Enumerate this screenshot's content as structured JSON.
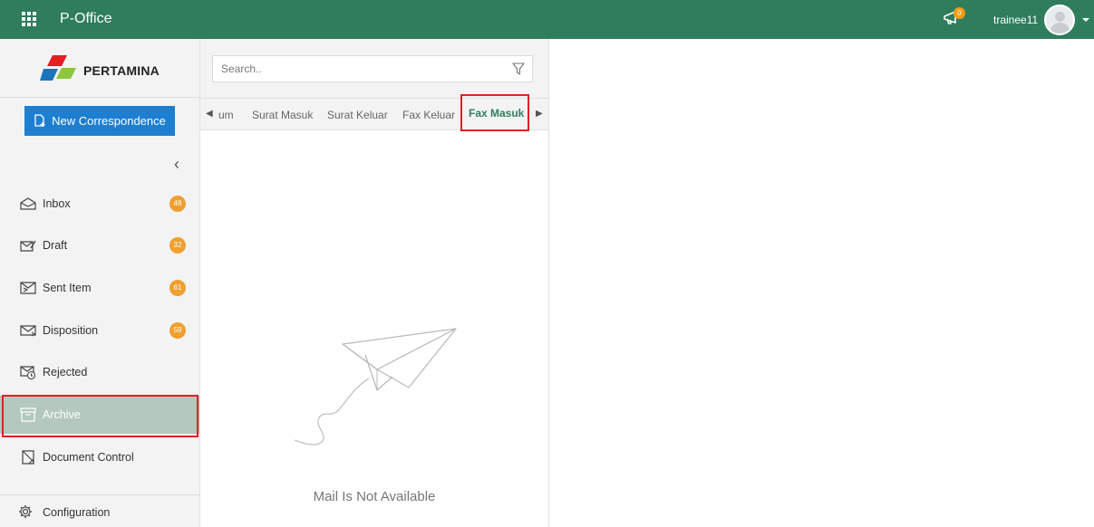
{
  "app": {
    "title": "P-Office"
  },
  "header": {
    "notification_count": "0",
    "username": "trainee11"
  },
  "sidebar": {
    "logo_text": "PERTAMINA",
    "new_button_label": "New Correspondence",
    "items": [
      {
        "label": "Inbox",
        "badge": "48",
        "icon": "inbox-icon"
      },
      {
        "label": "Draft",
        "badge": "32",
        "icon": "draft-icon"
      },
      {
        "label": "Sent Item",
        "badge": "61",
        "icon": "sent-icon"
      },
      {
        "label": "Disposition",
        "badge": "59",
        "icon": "disposition-icon"
      },
      {
        "label": "Rejected",
        "badge": "",
        "icon": "rejected-icon"
      },
      {
        "label": "Archive",
        "badge": "",
        "icon": "archive-icon",
        "active": true
      },
      {
        "label": "Document Control",
        "badge": "",
        "icon": "document-control-icon"
      }
    ],
    "configuration_label": "Configuration"
  },
  "search": {
    "placeholder": "Search.."
  },
  "tabs": [
    {
      "label": "um"
    },
    {
      "label": "Surat Masuk"
    },
    {
      "label": "Surat Keluar"
    },
    {
      "label": "Fax Keluar"
    },
    {
      "label": "Fax Masuk",
      "active": true
    }
  ],
  "empty_state": {
    "message": "Mail Is Not Available"
  },
  "colors": {
    "topbar": "#2f7d5d",
    "primary_button": "#1e7fd0",
    "badge": "#f0a030",
    "active_nav": "#b4c8bd",
    "highlight": "#e02020"
  }
}
